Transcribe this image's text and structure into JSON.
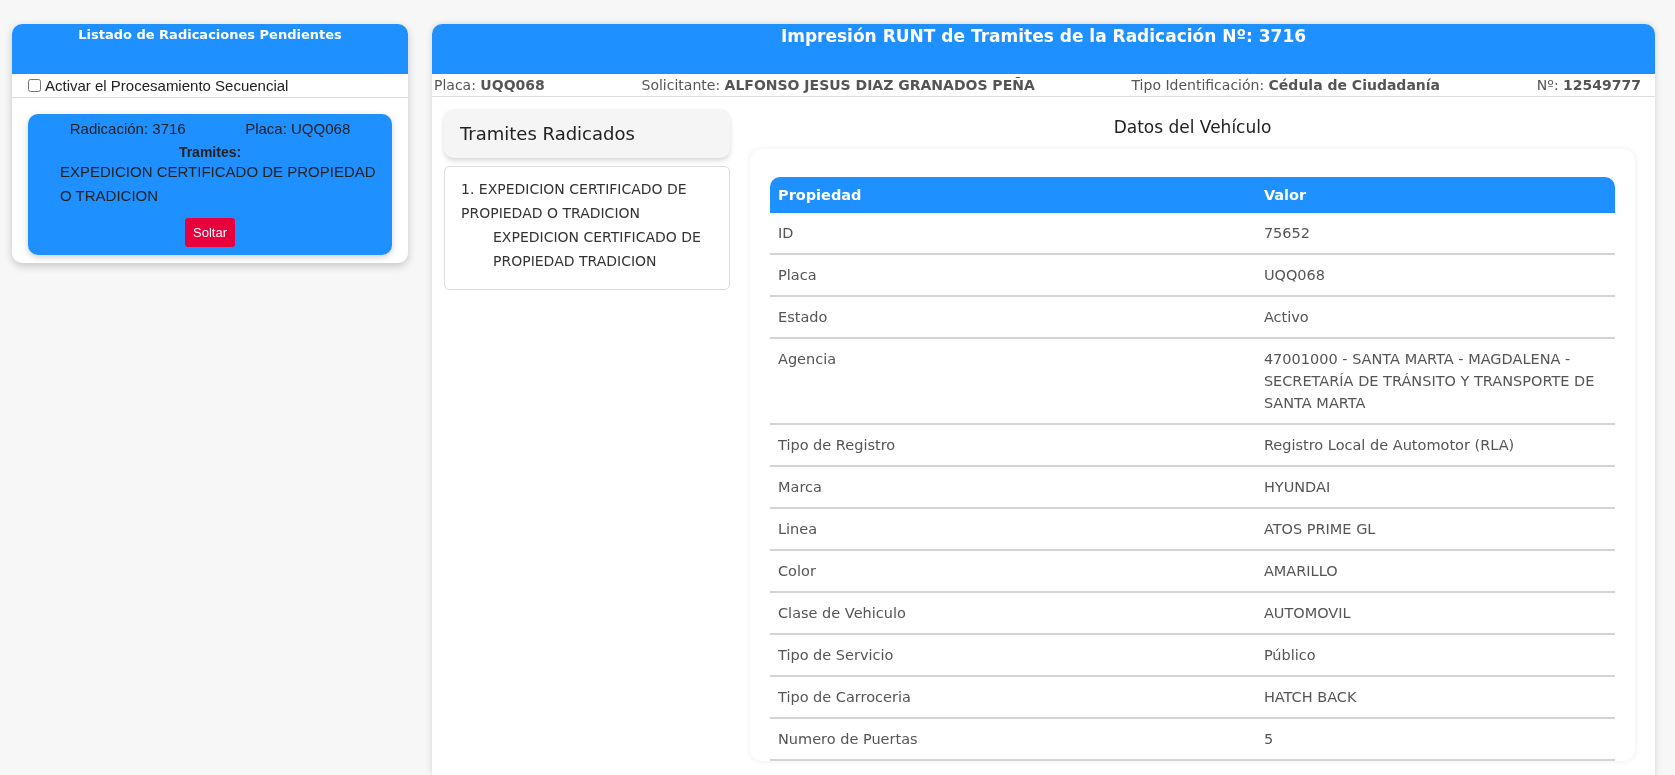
{
  "pending_panel": {
    "title": "Listado de Radicaciones Pendientes",
    "sequential_checkbox": {
      "label": "Activar el Procesamiento Secuencial",
      "checked": false
    },
    "cards": [
      {
        "radicacion": "Radicación: 3716",
        "placa": "Placa: UQQ068",
        "tramites_label": "Tramites:",
        "tramites": "EXPEDICION CERTIFICADO DE PROPIEDAD O TRADICION",
        "button": "Soltar"
      }
    ]
  },
  "main": {
    "title": "Impresión RUNT de Tramites de la Radicación Nº: 3716",
    "summary": [
      {
        "label": "Placa:",
        "value": "UQQ068"
      },
      {
        "label": "Solicitante:",
        "value": "ALFONSO JESUS DIAZ GRANADOS PEÑA"
      },
      {
        "label": "Tipo Identificación:",
        "value": "Cédula de Ciudadanía"
      },
      {
        "label": "Nº:",
        "value": "12549777"
      }
    ],
    "tramites_radicados": {
      "title": "Tramites Radicados",
      "items": [
        {
          "name": "1. EXPEDICION CERTIFICADO DE PROPIEDAD O TRADICION",
          "detail": "EXPEDICION CERTIFICADO DE PROPIEDAD TRADICION"
        }
      ]
    },
    "vehicle": {
      "title": "Datos del Vehículo",
      "columns": [
        "Propiedad",
        "Valor"
      ],
      "rows": [
        [
          "ID",
          "75652"
        ],
        [
          "Placa",
          "UQQ068"
        ],
        [
          "Estado",
          "Activo"
        ],
        [
          "Agencia",
          "47001000 - SANTA MARTA - MAGDALENA - SECRETARÍA DE TRÁNSITO Y TRANSPORTE DE SANTA MARTA"
        ],
        [
          "Tipo de Registro",
          "Registro Local de Automotor (RLA)"
        ],
        [
          "Marca",
          "HYUNDAI"
        ],
        [
          "Linea",
          "ATOS PRIME GL"
        ],
        [
          "Color",
          "AMARILLO"
        ],
        [
          "Clase de Vehiculo",
          "AUTOMOVIL"
        ],
        [
          "Tipo de Servicio",
          "Público"
        ],
        [
          "Tipo de Carroceria",
          "HATCH BACK"
        ],
        [
          "Numero de Puertas",
          "5"
        ]
      ]
    }
  }
}
